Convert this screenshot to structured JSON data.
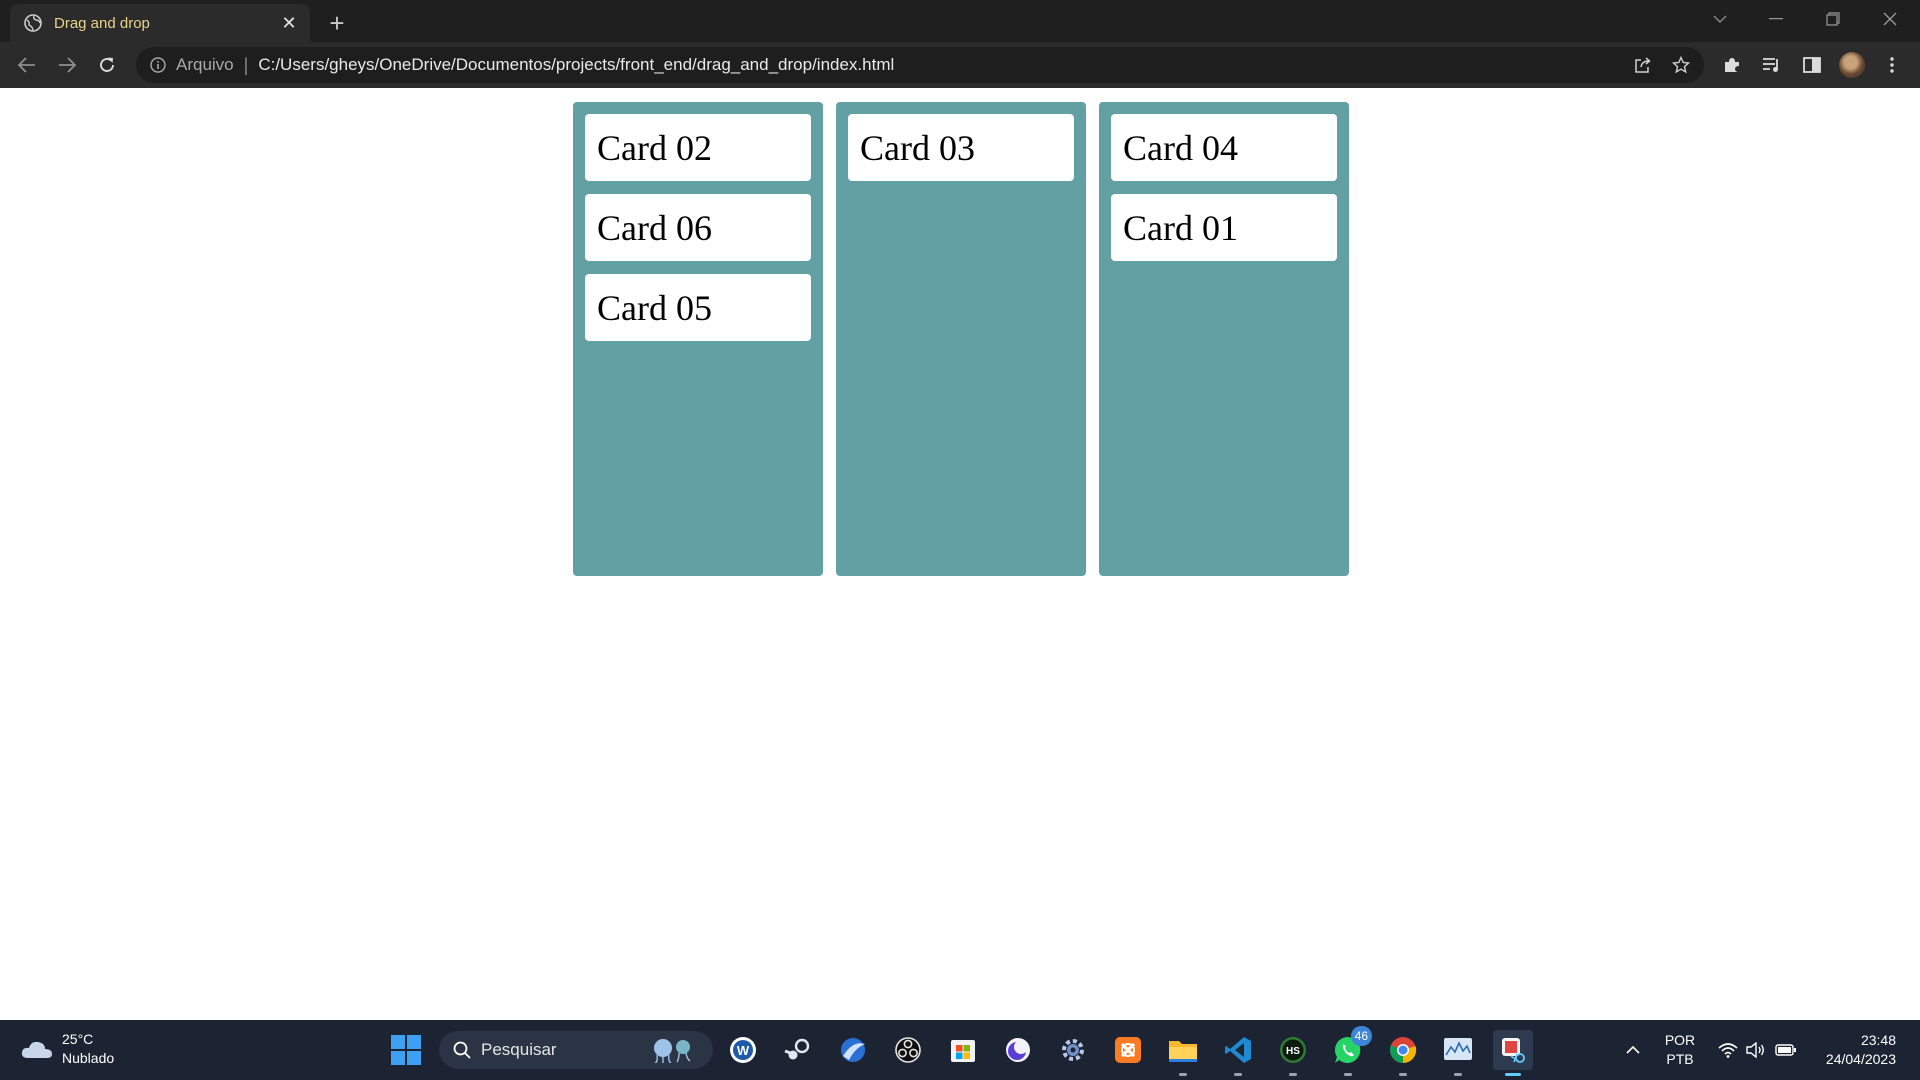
{
  "browser": {
    "tab_title": "Drag and drop",
    "omnibox": {
      "scheme_label": "Arquivo",
      "separator": "|",
      "url": "C:/Users/gheys/OneDrive/Documentos/projects/front_end/drag_and_drop/index.html"
    }
  },
  "board": {
    "columns": [
      {
        "cards": [
          "Card 02",
          "Card 06",
          "Card 05"
        ]
      },
      {
        "cards": [
          "Card 03"
        ]
      },
      {
        "cards": [
          "Card 04",
          "Card 01"
        ]
      }
    ]
  },
  "taskbar": {
    "weather": {
      "temperature": "25°C",
      "condition": "Nublado"
    },
    "search_placeholder": "Pesquisar",
    "whatsapp_badge": "46",
    "language": {
      "line1": "POR",
      "line2": "PTB"
    },
    "clock": {
      "time": "23:48",
      "date": "24/04/2023"
    }
  },
  "colors": {
    "column_bg": "#62a0a3",
    "card_bg": "#ffffff",
    "tab_title": "#e8d38a",
    "taskbar_bg": "#1c2433"
  }
}
